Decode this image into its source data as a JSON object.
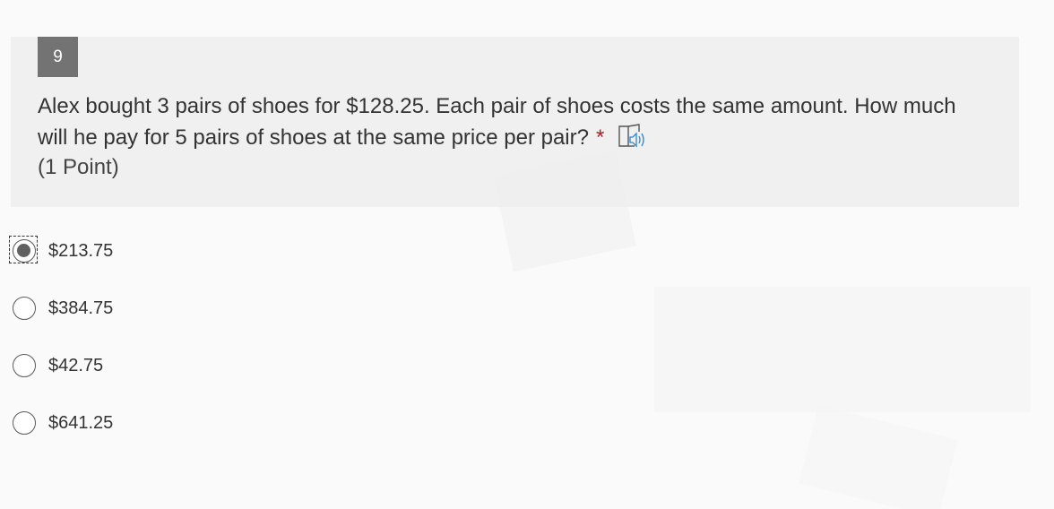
{
  "question": {
    "number": "9",
    "text": "Alex bought 3 pairs of shoes for $128.25.  Each pair of shoes costs the same amount.  How much will he pay for 5 pairs of shoes at the same price per pair?",
    "required_marker": "*",
    "points": "(1 Point)",
    "reader_icon": "immersive-reader-icon"
  },
  "options": [
    {
      "label": "$213.75",
      "checked": true
    },
    {
      "label": "$384.75",
      "checked": false
    },
    {
      "label": "$42.75",
      "checked": false
    },
    {
      "label": "$641.25",
      "checked": false
    }
  ],
  "colors": {
    "number_badge": "#737373",
    "required_star": "#a4262c",
    "reader_icon_accent": "#2b88d8",
    "card_background": "#eeeeee"
  }
}
